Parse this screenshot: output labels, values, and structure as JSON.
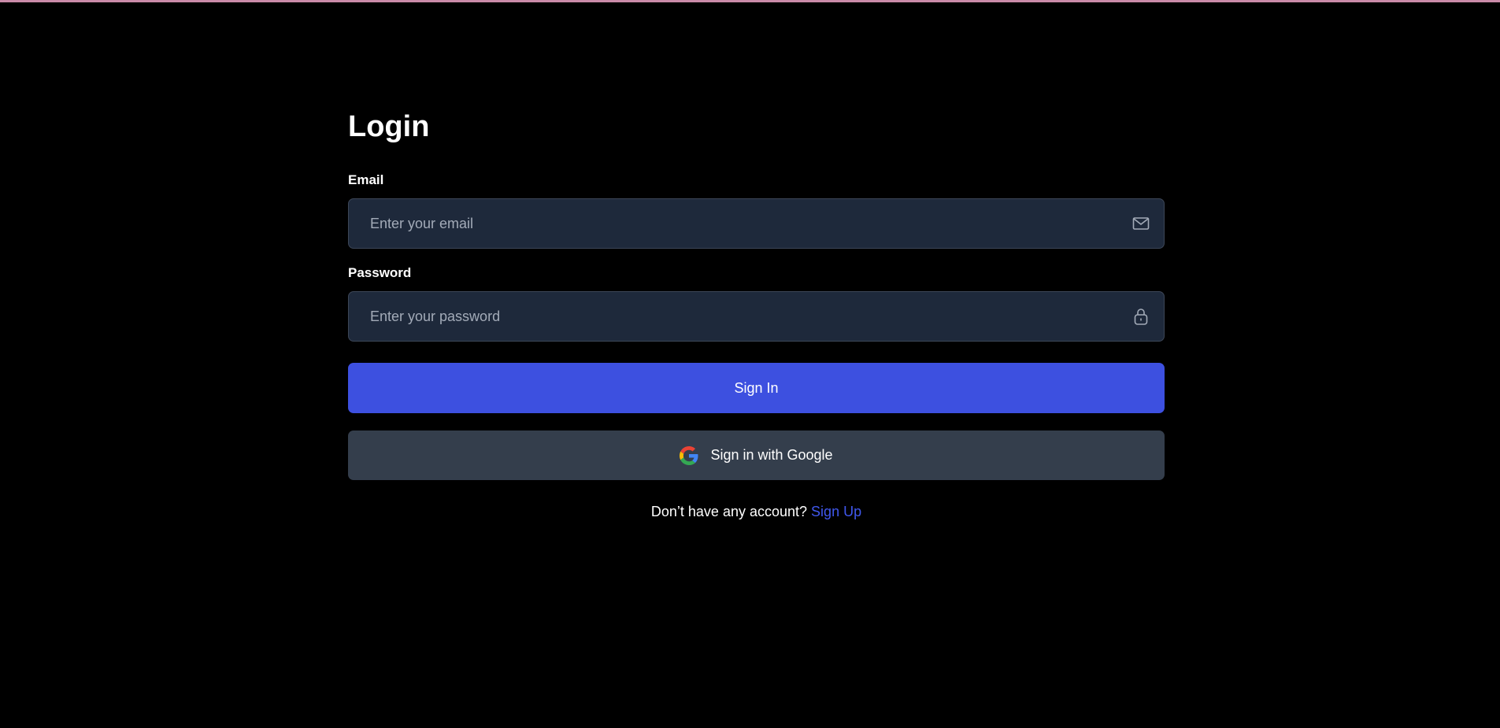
{
  "page": {
    "title": "Login",
    "accent_color": "#3d50e0",
    "background_color": "#000000",
    "top_strip_color": "#c98aa8"
  },
  "form": {
    "email": {
      "label": "Email",
      "placeholder": "Enter your email",
      "value": "",
      "icon": "mail-icon"
    },
    "password": {
      "label": "Password",
      "placeholder": "Enter your password",
      "value": "",
      "icon": "lock-icon"
    },
    "sign_in_label": "Sign In",
    "google_label": "Sign in with Google",
    "google_icon": "google-icon"
  },
  "footer": {
    "prompt": "Don’t have any account?",
    "signup_label": "Sign Up",
    "link_color": "#4058ee"
  }
}
